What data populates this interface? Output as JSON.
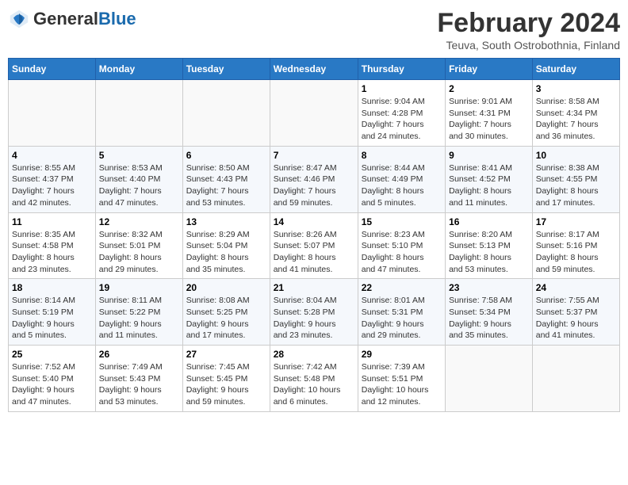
{
  "header": {
    "logo_general": "General",
    "logo_blue": "Blue",
    "month_title": "February 2024",
    "location": "Teuva, South Ostrobothnia, Finland"
  },
  "columns": [
    "Sunday",
    "Monday",
    "Tuesday",
    "Wednesday",
    "Thursday",
    "Friday",
    "Saturday"
  ],
  "weeks": [
    [
      {
        "day": "",
        "info": ""
      },
      {
        "day": "",
        "info": ""
      },
      {
        "day": "",
        "info": ""
      },
      {
        "day": "",
        "info": ""
      },
      {
        "day": "1",
        "info": "Sunrise: 9:04 AM\nSunset: 4:28 PM\nDaylight: 7 hours\nand 24 minutes."
      },
      {
        "day": "2",
        "info": "Sunrise: 9:01 AM\nSunset: 4:31 PM\nDaylight: 7 hours\nand 30 minutes."
      },
      {
        "day": "3",
        "info": "Sunrise: 8:58 AM\nSunset: 4:34 PM\nDaylight: 7 hours\nand 36 minutes."
      }
    ],
    [
      {
        "day": "4",
        "info": "Sunrise: 8:55 AM\nSunset: 4:37 PM\nDaylight: 7 hours\nand 42 minutes."
      },
      {
        "day": "5",
        "info": "Sunrise: 8:53 AM\nSunset: 4:40 PM\nDaylight: 7 hours\nand 47 minutes."
      },
      {
        "day": "6",
        "info": "Sunrise: 8:50 AM\nSunset: 4:43 PM\nDaylight: 7 hours\nand 53 minutes."
      },
      {
        "day": "7",
        "info": "Sunrise: 8:47 AM\nSunset: 4:46 PM\nDaylight: 7 hours\nand 59 minutes."
      },
      {
        "day": "8",
        "info": "Sunrise: 8:44 AM\nSunset: 4:49 PM\nDaylight: 8 hours\nand 5 minutes."
      },
      {
        "day": "9",
        "info": "Sunrise: 8:41 AM\nSunset: 4:52 PM\nDaylight: 8 hours\nand 11 minutes."
      },
      {
        "day": "10",
        "info": "Sunrise: 8:38 AM\nSunset: 4:55 PM\nDaylight: 8 hours\nand 17 minutes."
      }
    ],
    [
      {
        "day": "11",
        "info": "Sunrise: 8:35 AM\nSunset: 4:58 PM\nDaylight: 8 hours\nand 23 minutes."
      },
      {
        "day": "12",
        "info": "Sunrise: 8:32 AM\nSunset: 5:01 PM\nDaylight: 8 hours\nand 29 minutes."
      },
      {
        "day": "13",
        "info": "Sunrise: 8:29 AM\nSunset: 5:04 PM\nDaylight: 8 hours\nand 35 minutes."
      },
      {
        "day": "14",
        "info": "Sunrise: 8:26 AM\nSunset: 5:07 PM\nDaylight: 8 hours\nand 41 minutes."
      },
      {
        "day": "15",
        "info": "Sunrise: 8:23 AM\nSunset: 5:10 PM\nDaylight: 8 hours\nand 47 minutes."
      },
      {
        "day": "16",
        "info": "Sunrise: 8:20 AM\nSunset: 5:13 PM\nDaylight: 8 hours\nand 53 minutes."
      },
      {
        "day": "17",
        "info": "Sunrise: 8:17 AM\nSunset: 5:16 PM\nDaylight: 8 hours\nand 59 minutes."
      }
    ],
    [
      {
        "day": "18",
        "info": "Sunrise: 8:14 AM\nSunset: 5:19 PM\nDaylight: 9 hours\nand 5 minutes."
      },
      {
        "day": "19",
        "info": "Sunrise: 8:11 AM\nSunset: 5:22 PM\nDaylight: 9 hours\nand 11 minutes."
      },
      {
        "day": "20",
        "info": "Sunrise: 8:08 AM\nSunset: 5:25 PM\nDaylight: 9 hours\nand 17 minutes."
      },
      {
        "day": "21",
        "info": "Sunrise: 8:04 AM\nSunset: 5:28 PM\nDaylight: 9 hours\nand 23 minutes."
      },
      {
        "day": "22",
        "info": "Sunrise: 8:01 AM\nSunset: 5:31 PM\nDaylight: 9 hours\nand 29 minutes."
      },
      {
        "day": "23",
        "info": "Sunrise: 7:58 AM\nSunset: 5:34 PM\nDaylight: 9 hours\nand 35 minutes."
      },
      {
        "day": "24",
        "info": "Sunrise: 7:55 AM\nSunset: 5:37 PM\nDaylight: 9 hours\nand 41 minutes."
      }
    ],
    [
      {
        "day": "25",
        "info": "Sunrise: 7:52 AM\nSunset: 5:40 PM\nDaylight: 9 hours\nand 47 minutes."
      },
      {
        "day": "26",
        "info": "Sunrise: 7:49 AM\nSunset: 5:43 PM\nDaylight: 9 hours\nand 53 minutes."
      },
      {
        "day": "27",
        "info": "Sunrise: 7:45 AM\nSunset: 5:45 PM\nDaylight: 9 hours\nand 59 minutes."
      },
      {
        "day": "28",
        "info": "Sunrise: 7:42 AM\nSunset: 5:48 PM\nDaylight: 10 hours\nand 6 minutes."
      },
      {
        "day": "29",
        "info": "Sunrise: 7:39 AM\nSunset: 5:51 PM\nDaylight: 10 hours\nand 12 minutes."
      },
      {
        "day": "",
        "info": ""
      },
      {
        "day": "",
        "info": ""
      }
    ]
  ]
}
